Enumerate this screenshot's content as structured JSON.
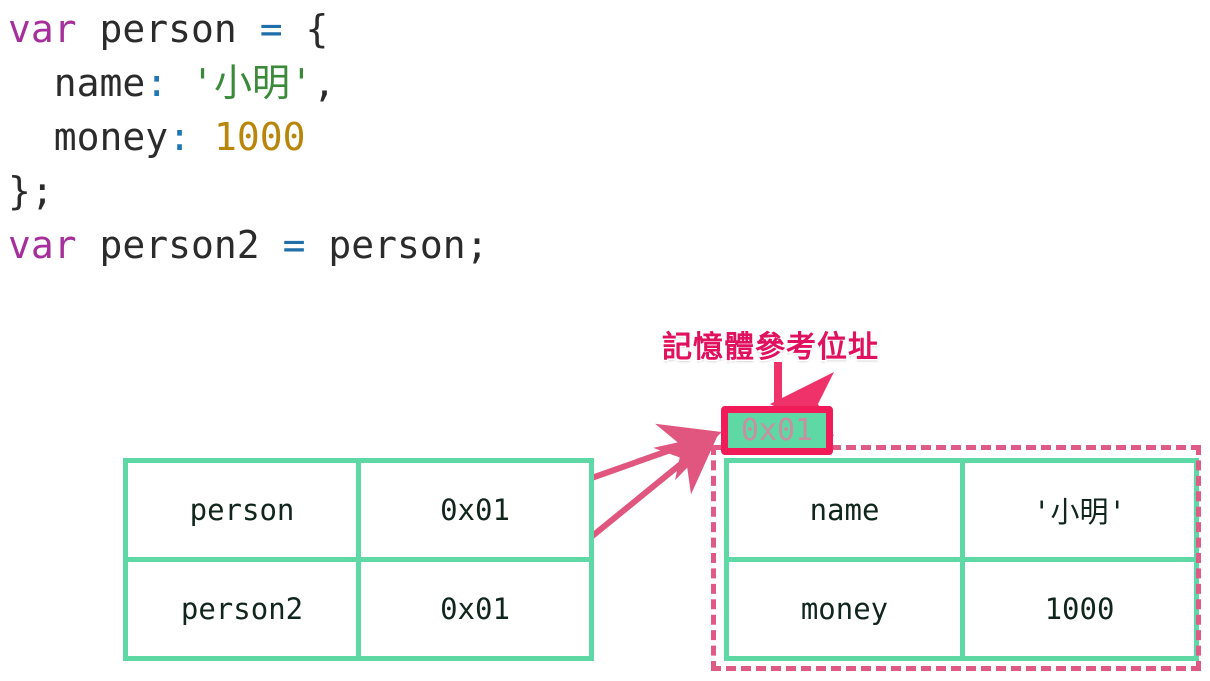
{
  "code": {
    "lines": [
      [
        {
          "t": "var",
          "c": "kw"
        },
        {
          "t": " ",
          "c": "punct"
        },
        {
          "t": "person",
          "c": "ident"
        },
        {
          "t": " ",
          "c": "punct"
        },
        {
          "t": "=",
          "c": "op"
        },
        {
          "t": " ",
          "c": "punct"
        },
        {
          "t": "{",
          "c": "punct"
        }
      ],
      [
        {
          "t": "  name",
          "c": "ident"
        },
        {
          "t": ":",
          "c": "colon"
        },
        {
          "t": " ",
          "c": "punct"
        },
        {
          "t": "'小明'",
          "c": "string"
        },
        {
          "t": ",",
          "c": "punct"
        }
      ],
      [
        {
          "t": "  money",
          "c": "ident"
        },
        {
          "t": ":",
          "c": "colon"
        },
        {
          "t": " ",
          "c": "punct"
        },
        {
          "t": "1000",
          "c": "number"
        }
      ],
      [
        {
          "t": "};",
          "c": "punct"
        }
      ],
      [
        {
          "t": "var",
          "c": "kw"
        },
        {
          "t": " ",
          "c": "punct"
        },
        {
          "t": "person2",
          "c": "ident"
        },
        {
          "t": " ",
          "c": "punct"
        },
        {
          "t": "=",
          "c": "op"
        },
        {
          "t": " ",
          "c": "punct"
        },
        {
          "t": "person;",
          "c": "ident"
        }
      ]
    ],
    "raw_text": "var person = {\n  name: '小明',\n  money: 1000\n};\nvar person2 = person;"
  },
  "annotation": {
    "memory_reference_label": "記憶體參考位址"
  },
  "address_chip": {
    "value": "0x01"
  },
  "stack_table": {
    "rows": [
      {
        "name": "person",
        "address": "0x01"
      },
      {
        "name": "person2",
        "address": "0x01"
      }
    ]
  },
  "heap_table": {
    "rows": [
      {
        "key": "name",
        "value": "'小明'"
      },
      {
        "key": "money",
        "value": "1000"
      }
    ]
  },
  "colors": {
    "keyword_purple": "#a6309b",
    "operator_blue": "#1f6fa8",
    "colon_blue": "#1f78b4",
    "string_green": "#3a8a3a",
    "number_amber": "#b8860b",
    "table_border_mint": "#5ed8a4",
    "address_green": "#2e7d32",
    "accent_pink": "#e05a86",
    "chip_border_pink": "#f21b5a",
    "chip_fill_green": "#5ed8a4",
    "label_crimson": "#e0115f",
    "text_dark": "#10251c",
    "background": "#ffffff"
  }
}
